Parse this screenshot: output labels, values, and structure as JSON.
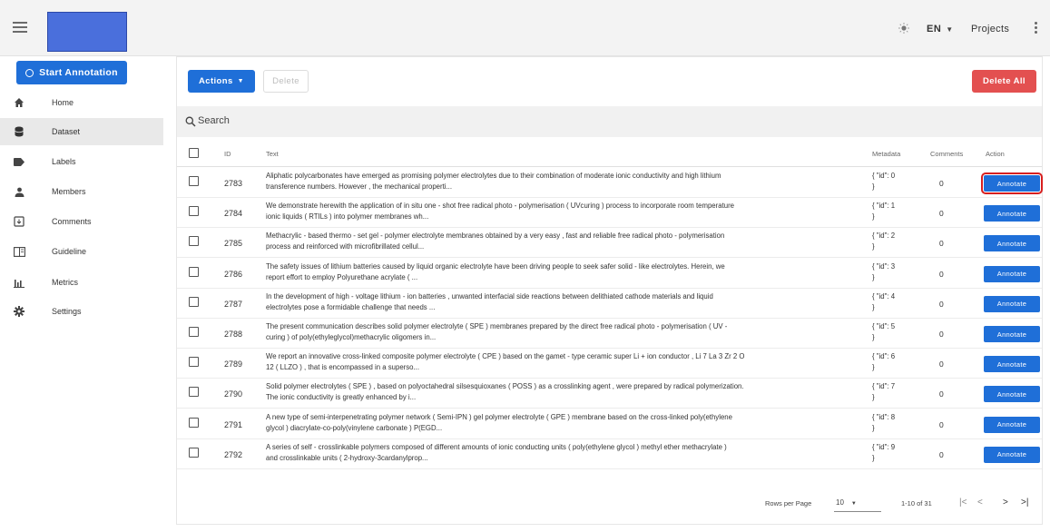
{
  "appbar": {
    "language": "EN",
    "projects_label": "Projects"
  },
  "sidebar": {
    "start_label": "Start Annotation",
    "items": [
      {
        "label": "Home",
        "icon": "home-icon"
      },
      {
        "label": "Dataset",
        "icon": "database-icon"
      },
      {
        "label": "Labels",
        "icon": "label-icon"
      },
      {
        "label": "Members",
        "icon": "person-icon"
      },
      {
        "label": "Comments",
        "icon": "comment-icon"
      },
      {
        "label": "Guideline",
        "icon": "book-icon"
      },
      {
        "label": "Metrics",
        "icon": "bar-chart-icon"
      },
      {
        "label": "Settings",
        "icon": "gear-icon"
      }
    ],
    "active_item": "Dataset"
  },
  "toolbar": {
    "actions_label": "Actions",
    "delete_label": "Delete",
    "delete_all_label": "Delete All"
  },
  "search": {
    "placeholder": "Search"
  },
  "table": {
    "headers": {
      "id": "ID",
      "text": "Text",
      "metadata": "Metadata",
      "comments": "Comments",
      "action": "Action"
    },
    "annotate_label": "Annotate",
    "rows": [
      {
        "id": "2783",
        "text": "Aliphatic polycarbonates have emerged as promising polymer electrolytes due to their combination of moderate ionic conductivity and high lithium\ntransference numbers. However , the mechanical properti...",
        "metadata": "{ \"id\": 0\n}",
        "comments": "0"
      },
      {
        "id": "2784",
        "text": "We demonstrate herewith the application of in situ one - shot free radical photo - polymerisation ( UVcuring ) process to incorporate room temperature\nionic liquids ( RTILs ) into polymer membranes wh...",
        "metadata": "{ \"id\": 1\n}",
        "comments": "0"
      },
      {
        "id": "2785",
        "text": "Methacrylic - based thermo - set gel - polymer electrolyte membranes obtained by a very easy , fast and reliable free radical photo - polymerisation\nprocess and reinforced with microfibrillated cellul...",
        "metadata": "{ \"id\": 2\n}",
        "comments": "0"
      },
      {
        "id": "2786",
        "text": "The safety issues of lithium batteries caused by liquid organic electrolyte have been driving people to seek safer solid - like electrolytes. Herein,  we\nreport effort to employ Polyurethane acrylate ( ...",
        "metadata": "{ \"id\": 3\n}",
        "comments": "0"
      },
      {
        "id": "2787",
        "text": "In the development of high - voltage lithium - ion batteries , unwanted interfacial side reactions between delithiated cathode materials and liquid\nelectrolytes pose a formidable challenge that needs ...",
        "metadata": "{ \"id\": 4\n}",
        "comments": "0"
      },
      {
        "id": "2788",
        "text": "The present communication describes solid polymer electrolyte ( SPE ) membranes prepared by the direct free radical photo - polymerisation ( UV -\ncuring ) of poly(ethyleglycol)methacrylic oligomers in...",
        "metadata": "{ \"id\": 5\n}",
        "comments": "0"
      },
      {
        "id": "2789",
        "text": "We report an innovative cross-linked composite polymer electrolyte ( CPE ) based on the gamet - type ceramic super Li + ion conductor , Li 7 La 3 Zr 2 O\n12 ( LLZO ) , that is encompassed in a superso...",
        "metadata": "{ \"id\": 6\n}",
        "comments": "0"
      },
      {
        "id": "2790",
        "text": "Solid polymer electrolytes ( SPE ) , based on polyoctahedral silsesquioxanes ( POSS ) as a crosslinking agent , were prepared by radical polymerization.\nThe ionic conductivity is greatly enhanced by i...",
        "metadata": "{ \"id\": 7\n}",
        "comments": "0"
      },
      {
        "id": "2791",
        "text": "A new type of semi-interpenetrating polymer network ( Semi-IPN ) gel polymer electrolyte ( GPE ) membrane based on the cross-linked poly(ethylene\nglycol ) diacrylate-co-poly(vinylene carbonate ) P(EGD...",
        "metadata": "{ \"id\": 8\n}",
        "comments": "0"
      },
      {
        "id": "2792",
        "text": "A series of self - crosslinkable polymers composed of different amounts of ionic conducting units ( poly(ethylene glycol ) methyl ether methacrylate )\nand crosslinkable units ( 2-hydroxy-3cardanylprop...",
        "metadata": "{ \"id\": 9\n}",
        "comments": "0"
      }
    ]
  },
  "footer": {
    "rows_per_page_label": "Rows per Page",
    "rows_per_page_value": "10",
    "range_text": "1-10 of 31"
  },
  "colors": {
    "primary": "#1f6fd8",
    "danger": "#e35050",
    "highlight": "#d81f1f"
  }
}
